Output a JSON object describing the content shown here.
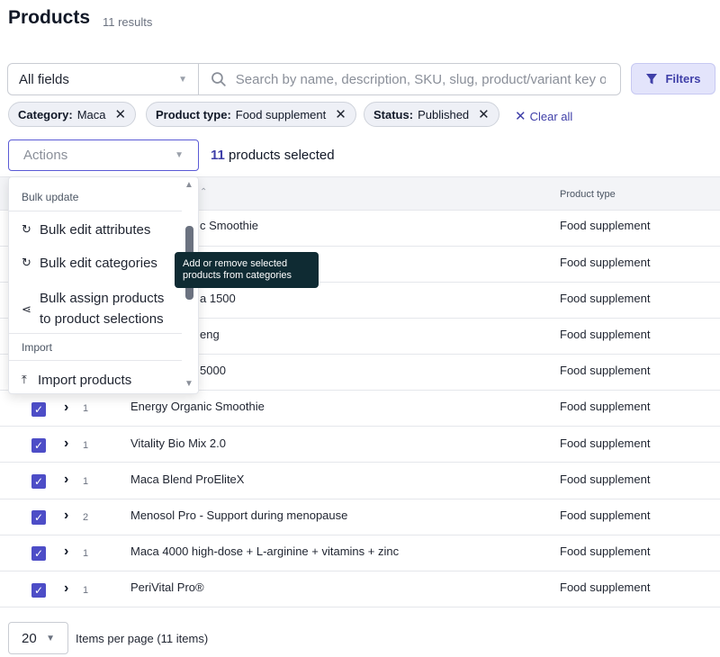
{
  "header": {
    "title": "Products",
    "results": "11 results"
  },
  "search": {
    "field": "All fields",
    "placeholder": "Search by name, description, SKU, slug, product/variant key or",
    "filters_label": "Filters"
  },
  "chips": [
    {
      "key": "Category:",
      "value": "Maca"
    },
    {
      "key": "Product type:",
      "value": "Food supplement"
    },
    {
      "key": "Status:",
      "value": "Published"
    }
  ],
  "clear_all": "Clear all",
  "actions": {
    "placeholder": "Actions",
    "selected_num": "11",
    "selected_text": " products selected"
  },
  "table": {
    "col_product_type": "Product type"
  },
  "rows": [
    {
      "name": "c Smoothie",
      "count": "",
      "type": "Food supplement"
    },
    {
      "name": "",
      "count": "",
      "type": "Food supplement"
    },
    {
      "name": "a 1500",
      "count": "",
      "type": "Food supplement"
    },
    {
      "name": "eng",
      "count": "",
      "type": "Food supplement"
    },
    {
      "name": "5000",
      "count": "",
      "type": "Food supplement"
    },
    {
      "name": "Energy Organic Smoothie",
      "count": "1",
      "type": "Food supplement"
    },
    {
      "name": "Vitality Bio Mix 2.0",
      "count": "1",
      "type": "Food supplement"
    },
    {
      "name": "Maca Blend ProEliteX",
      "count": "1",
      "type": "Food supplement"
    },
    {
      "name": "Menosol Pro - Support during menopause",
      "count": "2",
      "type": "Food supplement"
    },
    {
      "name": "Maca 4000 high-dose + L-arginine + vitamins + zinc",
      "count": "1",
      "type": "Food supplement"
    },
    {
      "name": "PeriVital Pro®",
      "count": "1",
      "type": "Food supplement"
    }
  ],
  "dropdown": {
    "section_bulk": "Bulk update",
    "item_attributes": "Bulk edit attributes",
    "item_categories": "Bulk edit categories",
    "item_assign_line1": "Bulk assign products",
    "item_assign_line2": "to product selections",
    "section_import": "Import",
    "item_import": "Import products"
  },
  "tooltip": {
    "line1": "Add or remove selected",
    "line2": "products from categories"
  },
  "footer": {
    "page_size": "20",
    "per_page": "Items per page (11 items)"
  },
  "colors": {
    "accent": "#4d4dc7",
    "accent_light": "#e3e4fb",
    "tooltip_bg": "#0f2b33"
  },
  "icons": [
    "search-icon",
    "filter-icon",
    "close-icon",
    "chevron-right-icon",
    "refresh-icon",
    "share-icon",
    "upload-icon",
    "caret-down-icon"
  ]
}
